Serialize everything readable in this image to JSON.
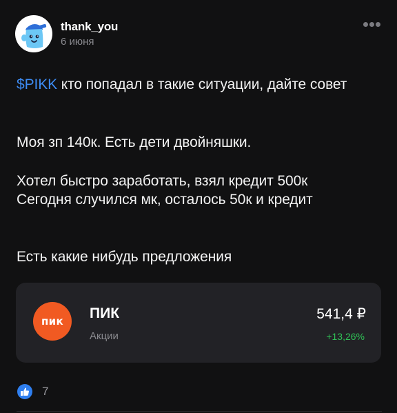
{
  "author": {
    "name": "thank_you",
    "date": "6 июня"
  },
  "post": {
    "ticker": "$PIKK",
    "line1_rest": " кто попадал в такие ситуации, дайте совет",
    "paragraph2": "Моя зп 140к. Есть дети двойняшки.",
    "paragraph3_line1": "Хотел быстро заработать, взял кредит 500к",
    "paragraph3_line2": "Сегодня случился мк, осталось 50к и кредит",
    "paragraph4": "Есть какие нибудь предложения"
  },
  "instrument": {
    "logo_text": "пик",
    "name": "ПИК",
    "type": "Акции",
    "price": "541,4 ₽",
    "change": "+13,26%"
  },
  "reactions": {
    "icon": "thumbs-up-icon",
    "count": "7"
  },
  "colors": {
    "background": "#111112",
    "accent_link": "#3d8bf2",
    "positive": "#2fbf55",
    "pik_brand": "#f15a22",
    "like": "#2f7fef"
  },
  "icons": {
    "avatar": "blue-character-avatar",
    "more": "more-dots-icon"
  }
}
